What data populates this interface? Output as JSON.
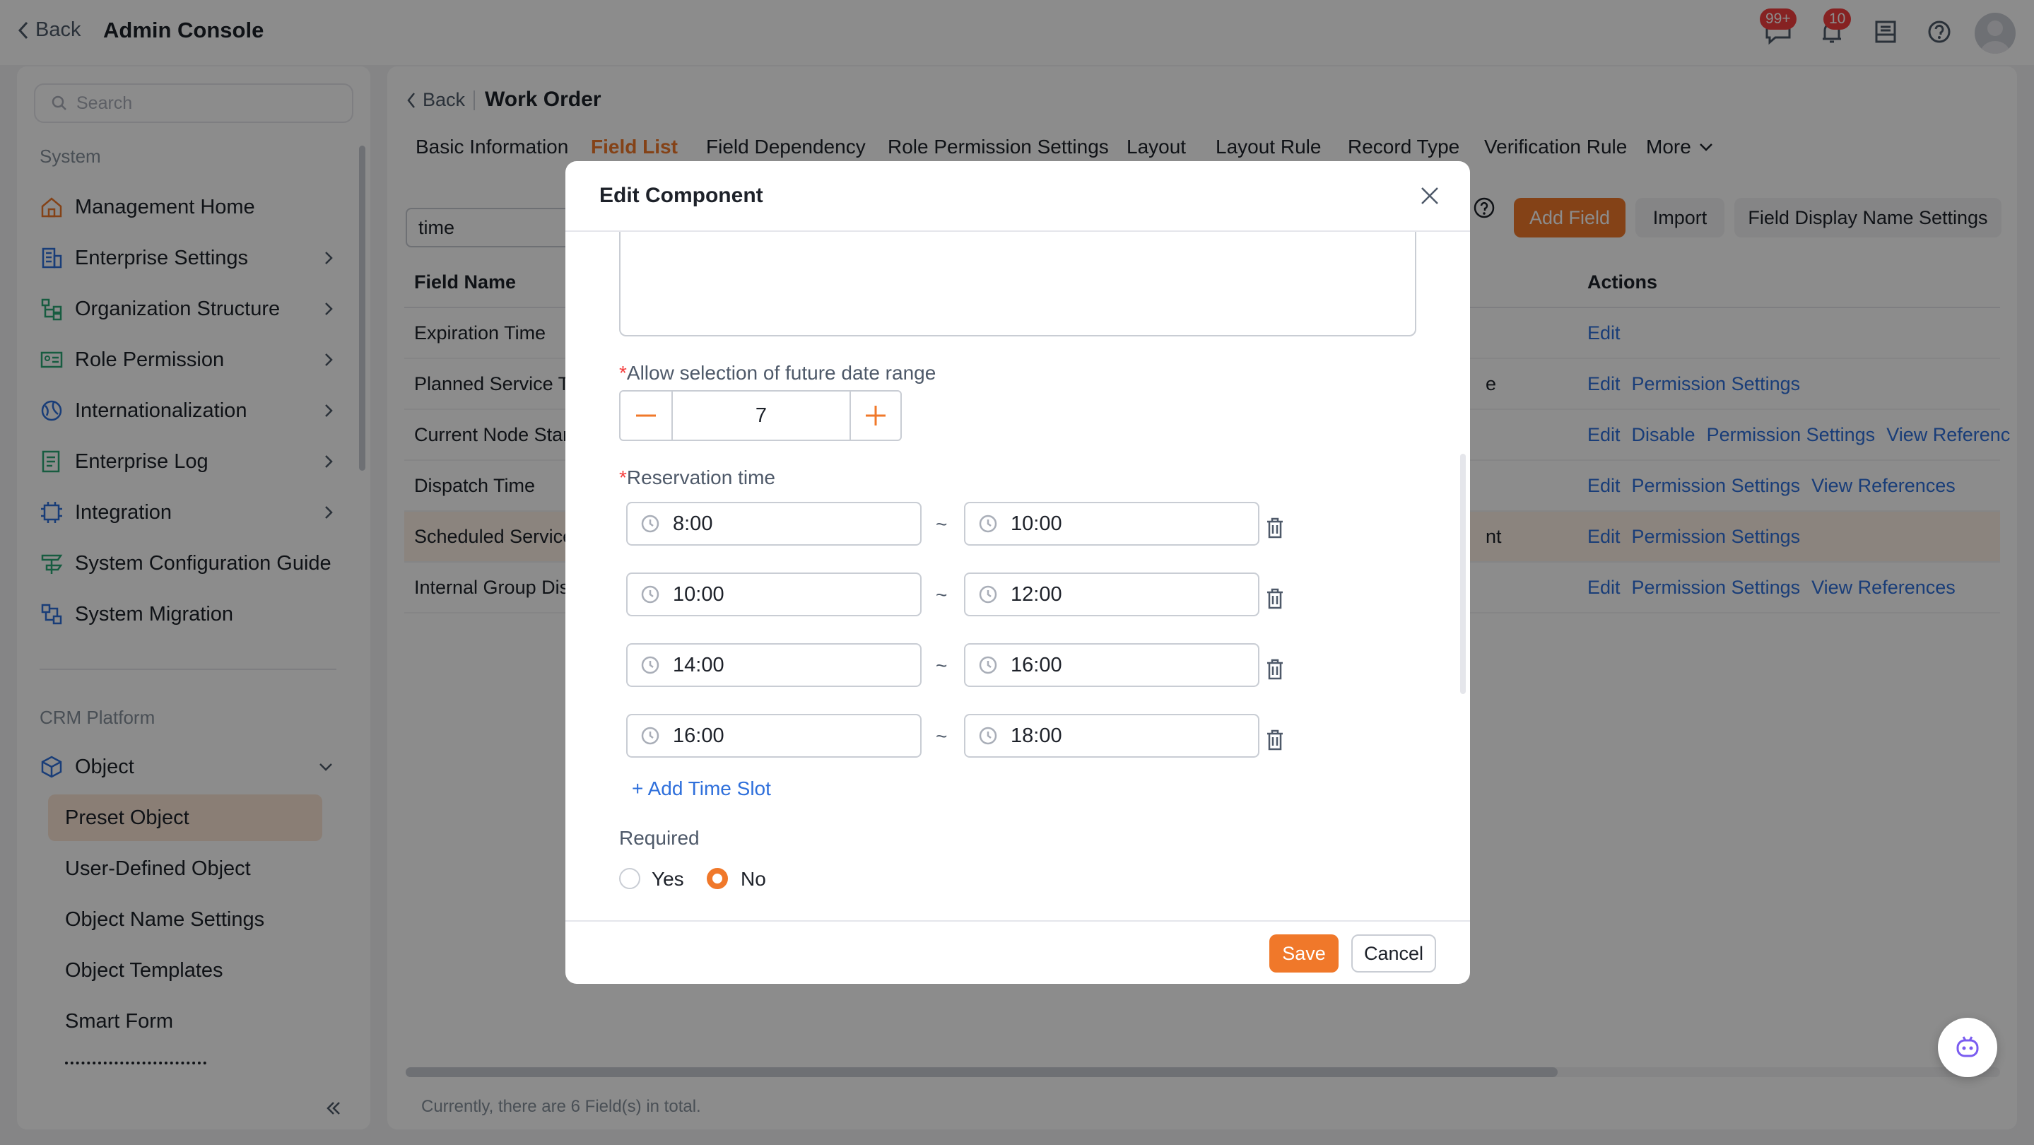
{
  "topbar": {
    "back_label": "Back",
    "title": "Admin Console",
    "messages_badge": "99+",
    "notifications_badge": "10"
  },
  "sidebar": {
    "search_placeholder": "Search",
    "system_title": "System",
    "items": [
      {
        "label": "Management Home",
        "icon": "home-icon"
      },
      {
        "label": "Enterprise Settings",
        "icon": "building-icon"
      },
      {
        "label": "Organization Structure",
        "icon": "org-icon"
      },
      {
        "label": "Role Permission",
        "icon": "id-card-icon"
      },
      {
        "label": "Internationalization",
        "icon": "globe-icon"
      },
      {
        "label": "Enterprise Log",
        "icon": "log-icon"
      },
      {
        "label": "Integration",
        "icon": "integration-icon"
      },
      {
        "label": "System Configuration Guide",
        "icon": "guide-icon"
      },
      {
        "label": "System Migration",
        "icon": "migration-icon"
      }
    ],
    "crm_title": "CRM Platform",
    "object_label": "Object",
    "sub_items": [
      "Preset Object",
      "User-Defined Object",
      "Object Name Settings",
      "Object Templates",
      "Smart Form"
    ]
  },
  "main": {
    "back_label": "Back",
    "title": "Work Order",
    "tabs": [
      "Basic Information",
      "Field List",
      "Field Dependency",
      "Role Permission Settings",
      "Layout",
      "Layout Rule",
      "Record Type",
      "Verification Rule",
      "More"
    ],
    "filter_value": "time",
    "buttons": {
      "add_field": "Add Field",
      "import": "Import",
      "display_name_settings": "Field Display Name Settings"
    },
    "table": {
      "header_field": "Field Name",
      "header_actions": "Actions",
      "rows": [
        {
          "name": "Expiration Time",
          "mid": "",
          "actions": [
            "Edit"
          ]
        },
        {
          "name": "Planned Service T",
          "mid": "e",
          "actions": [
            "Edit",
            "Permission Settings"
          ]
        },
        {
          "name": "Current Node Star",
          "mid": "",
          "actions": [
            "Edit",
            "Disable",
            "Permission Settings",
            "View Referenc"
          ]
        },
        {
          "name": "Dispatch Time",
          "mid": "",
          "actions": [
            "Edit",
            "Permission Settings",
            "View References"
          ]
        },
        {
          "name": "Scheduled Service",
          "mid": "nt",
          "actions": [
            "Edit",
            "Permission Settings"
          ]
        },
        {
          "name": "Internal Group Dis",
          "mid": "",
          "actions": [
            "Edit",
            "Permission Settings",
            "View References"
          ]
        }
      ]
    },
    "footer_text": "Currently, there are 6 Field(s) in total."
  },
  "modal": {
    "title": "Edit Component",
    "future_range_label": "Allow selection of future date range",
    "future_range_value": "7",
    "reservation_label": "Reservation time",
    "slots": [
      {
        "start": "8:00",
        "end": "10:00"
      },
      {
        "start": "10:00",
        "end": "12:00"
      },
      {
        "start": "14:00",
        "end": "16:00"
      },
      {
        "start": "16:00",
        "end": "18:00"
      }
    ],
    "tilde": "~",
    "add_slot_label": "+ Add Time Slot",
    "required_label": "Required",
    "yes_label": "Yes",
    "no_label": "No",
    "required_selected": "No",
    "save_label": "Save",
    "cancel_label": "Cancel"
  },
  "colors": {
    "accent": "#f0782a",
    "link": "#2e6fdb",
    "required": "#f53f3f"
  }
}
